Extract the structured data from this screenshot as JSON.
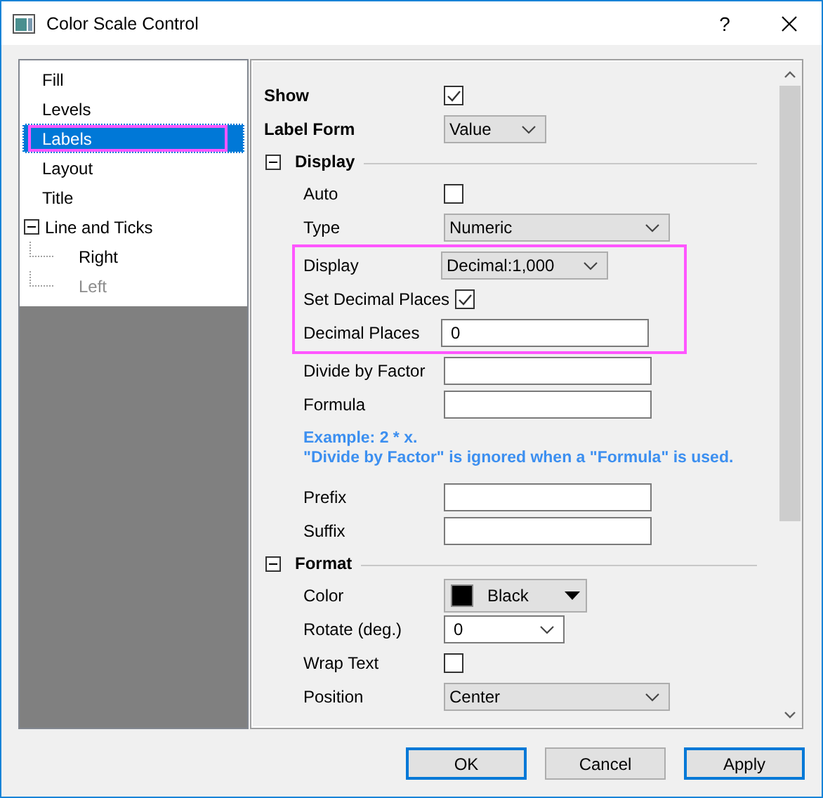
{
  "window": {
    "title": "Color Scale Control",
    "help": "?"
  },
  "tree": [
    {
      "label": "Fill",
      "selected": false,
      "highlighted": false
    },
    {
      "label": "Levels",
      "selected": false,
      "highlighted": false
    },
    {
      "label": "Labels",
      "selected": true,
      "highlighted": true
    },
    {
      "label": "Layout",
      "selected": false,
      "highlighted": false
    },
    {
      "label": "Title",
      "selected": false,
      "highlighted": false
    },
    {
      "label": "Line and Ticks",
      "selected": false,
      "highlighted": false,
      "expanded": true,
      "children": [
        {
          "label": "Right",
          "disabled": false
        },
        {
          "label": "Left",
          "disabled": true
        }
      ]
    }
  ],
  "top_rows": [
    {
      "kind": "checkbox",
      "label": "Show",
      "checked": true
    },
    {
      "kind": "combo",
      "label": "Label Form",
      "value": "Value"
    }
  ],
  "sections": [
    {
      "title": "Display",
      "expanded": true,
      "rows": [
        {
          "kind": "checkbox",
          "label": "Auto",
          "checked": false,
          "highlighted": false
        },
        {
          "kind": "combo",
          "label": "Type",
          "value": "Numeric",
          "highlighted": false
        },
        {
          "kind": "combo",
          "label": "Display",
          "value": "Decimal:1,000",
          "highlighted": true
        },
        {
          "kind": "checkbox",
          "label": "Set Decimal Places",
          "checked": true,
          "highlighted": true
        },
        {
          "kind": "input",
          "label": "Decimal Places",
          "value": "0",
          "highlighted": true
        },
        {
          "kind": "input",
          "label": "Divide by Factor",
          "highlighted": false
        },
        {
          "kind": "input",
          "label": "Formula",
          "highlighted": false
        },
        {
          "kind": "note",
          "lines": [
            "Example: 2 * x.",
            "\"Divide by Factor\" is ignored when a \"Formula\" is used."
          ],
          "highlighted": false
        },
        {
          "kind": "input",
          "label": "Prefix",
          "highlighted": false
        },
        {
          "kind": "input",
          "label": "Suffix",
          "highlighted": false
        }
      ]
    },
    {
      "title": "Format",
      "expanded": true,
      "rows": [
        {
          "kind": "color",
          "label": "Color",
          "value": "Black",
          "color": "#000000",
          "highlighted": false
        },
        {
          "kind": "editable-combo",
          "label": "Rotate (deg.)",
          "value": "0",
          "highlighted": false
        },
        {
          "kind": "checkbox",
          "label": "Wrap Text",
          "checked": false,
          "highlighted": false
        },
        {
          "kind": "combo",
          "label": "Position",
          "value": "Center",
          "highlighted": false
        }
      ]
    }
  ],
  "buttons": [
    {
      "label": "OK",
      "default": true
    },
    {
      "label": "Cancel",
      "default": false
    },
    {
      "label": "Apply",
      "default": true
    }
  ]
}
